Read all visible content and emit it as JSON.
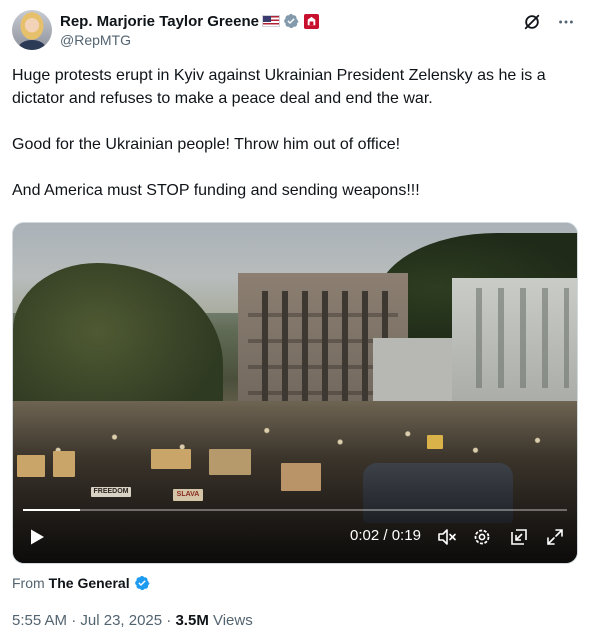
{
  "author": {
    "display_name": "Rep. Marjorie Taylor Greene",
    "handle": "@RepMTG",
    "flag_icon": "us-flag-icon",
    "badge_icon": "gray-verified-badge-icon",
    "affiliation_icon": "us-house-seal-icon"
  },
  "header_actions": {
    "grok_icon": "grok-icon",
    "more_icon": "more-icon"
  },
  "tweet": {
    "paragraphs": [
      "Huge protests erupt in Kyiv against Ukrainian President Zelensky as he is a dictator and refuses to make a peace deal and end the war.",
      "Good for the Ukrainian people! Throw him out of office!",
      "And America must STOP funding and sending weapons!!!"
    ]
  },
  "video": {
    "current_time": "0:02",
    "separator": " / ",
    "duration": "0:19",
    "progress": 0.105,
    "signs": [
      "FREEDOM",
      "SLAVA"
    ]
  },
  "from": {
    "label": "From",
    "name": "The General"
  },
  "meta": {
    "timestamp": "5:55 AM",
    "dot1": " · ",
    "date": "Jul 23, 2025",
    "dot2": " · ",
    "views_count": "3.5M",
    "views_label": " Views"
  },
  "colors": {
    "text_primary": "#0f1419",
    "text_secondary": "#536471",
    "verified_blue": "#1d9bf0",
    "verified_gray": "#829aab",
    "house_red": "#c8102e"
  }
}
